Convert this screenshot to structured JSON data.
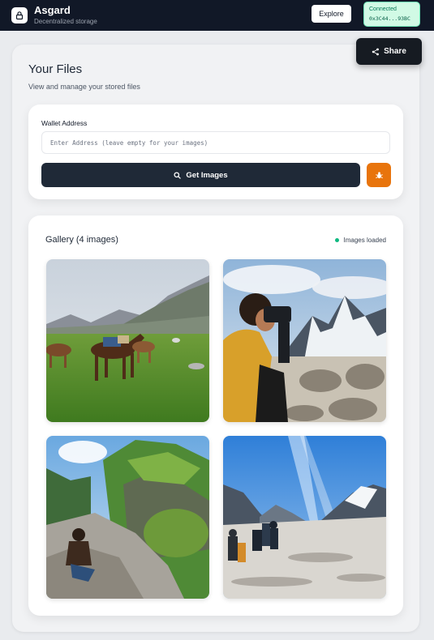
{
  "app": {
    "title": "Asgard",
    "subtitle": "Decentralized storage"
  },
  "header": {
    "explore_label": "Explore",
    "connection": {
      "status": "Connected",
      "address": "0x3C44...93BC"
    }
  },
  "share": {
    "label": "Share"
  },
  "page": {
    "title": "Your Files",
    "subtitle": "View and manage your stored files"
  },
  "wallet": {
    "label": "Wallet Address",
    "placeholder": "Enter Address (leave empty for your images)",
    "value": "",
    "get_images_label": "Get Images"
  },
  "gallery": {
    "title": "Gallery (4 images)",
    "status": "Images loaded",
    "images": [
      {
        "subject": "horses grazing in mountain meadow"
      },
      {
        "subject": "photographer with camera in snowy mountains"
      },
      {
        "subject": "person sitting on rocks by green cliff"
      },
      {
        "subject": "hikers on snowy mountain trail"
      }
    ]
  },
  "colors": {
    "topbar": "#111827",
    "accent_button": "#1f2937",
    "bug_button": "#e8740c",
    "connected_bg": "#d1fae5",
    "status_dot": "#10b981"
  }
}
